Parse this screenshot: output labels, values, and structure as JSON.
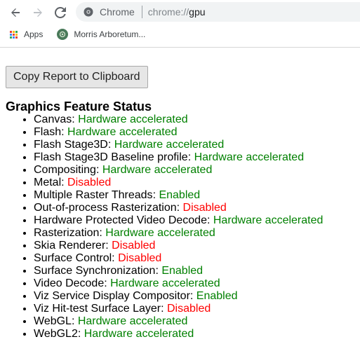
{
  "toolbar": {
    "site_label": "Chrome",
    "url_scheme": "chrome://",
    "url_host": "gpu"
  },
  "bookmarks": [
    {
      "label": "Apps",
      "icon": "apps-grid-icon"
    },
    {
      "label": "Morris Arboretum...",
      "icon": "morris-arboretum-favicon"
    }
  ],
  "main": {
    "copy_button_label": "Copy Report to Clipboard",
    "section_title": "Graphics Feature Status",
    "features": [
      {
        "name": "Canvas",
        "status": "Hardware accelerated"
      },
      {
        "name": "Flash",
        "status": "Hardware accelerated"
      },
      {
        "name": "Flash Stage3D",
        "status": "Hardware accelerated"
      },
      {
        "name": "Flash Stage3D Baseline profile",
        "status": "Hardware accelerated"
      },
      {
        "name": "Compositing",
        "status": "Hardware accelerated"
      },
      {
        "name": "Metal",
        "status": "Disabled"
      },
      {
        "name": "Multiple Raster Threads",
        "status": "Enabled"
      },
      {
        "name": "Out-of-process Rasterization",
        "status": "Disabled"
      },
      {
        "name": "Hardware Protected Video Decode",
        "status": "Hardware accelerated"
      },
      {
        "name": "Rasterization",
        "status": "Hardware accelerated"
      },
      {
        "name": "Skia Renderer",
        "status": "Disabled"
      },
      {
        "name": "Surface Control",
        "status": "Disabled"
      },
      {
        "name": "Surface Synchronization",
        "status": "Enabled"
      },
      {
        "name": "Video Decode",
        "status": "Hardware accelerated"
      },
      {
        "name": "Viz Service Display Compositor",
        "status": "Enabled"
      },
      {
        "name": "Viz Hit-test Surface Layer",
        "status": "Disabled"
      },
      {
        "name": "WebGL",
        "status": "Hardware accelerated"
      },
      {
        "name": "WebGL2",
        "status": "Hardware accelerated"
      }
    ]
  },
  "colors": {
    "status_good": "#008000",
    "status_bad": "#ff0000",
    "omnibox_bg": "#f1f3f4"
  }
}
